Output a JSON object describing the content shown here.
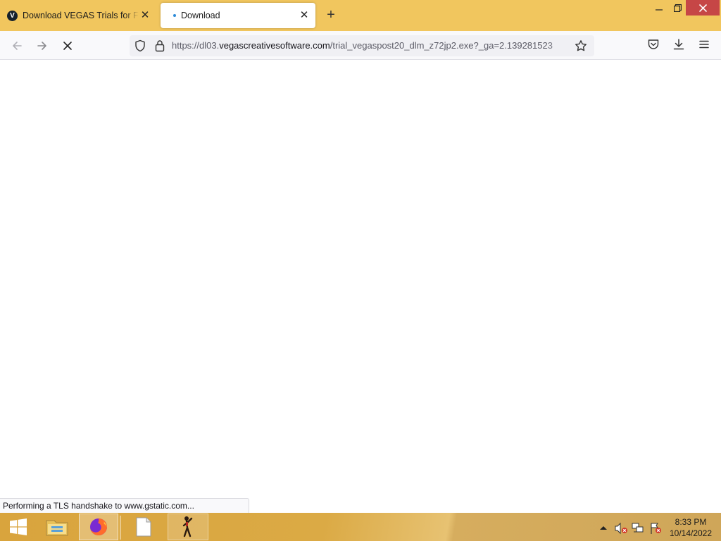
{
  "browser": {
    "tabs": [
      {
        "title": "Download VEGAS Trials for Free",
        "favicon_letter": "V",
        "active": false
      },
      {
        "title": "Download",
        "active": true,
        "loading": true
      }
    ],
    "window_controls": {
      "minimize": "—",
      "maximize": "❐",
      "close": "✕"
    },
    "newtab_label": "+"
  },
  "navbar": {
    "url_scheme": "https://dl03.",
    "url_host": "vegascreativesoftware.com",
    "url_path": "/trial_vegaspost20_dlm_z72jp2.exe?_ga=2.139281523"
  },
  "status": {
    "text": "Performing a TLS handshake to www.gstatic.com..."
  },
  "taskbar": {
    "items": [
      "start",
      "file-explorer",
      "firefox",
      "blank-file",
      "figure-app"
    ],
    "clock_time": "8:33 PM",
    "clock_date": "10/14/2022"
  },
  "colors": {
    "tabstrip": "#f1c65e",
    "taskbar": "#d9a43d",
    "close_button": "#c64646"
  }
}
